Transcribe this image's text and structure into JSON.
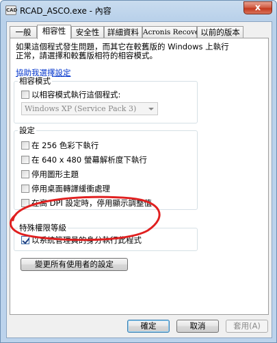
{
  "window": {
    "title": "RCAD_ASCO.exe - 內容",
    "app_icon_text": "CAD",
    "close_glyph": "x"
  },
  "tabs": [
    {
      "label": "一般",
      "active": false
    },
    {
      "label": "相容性",
      "active": true
    },
    {
      "label": "安全性",
      "active": false
    },
    {
      "label": "詳細資料",
      "active": false
    },
    {
      "label": "Acronis Recovery",
      "active": false
    },
    {
      "label": "以前的版本",
      "active": false
    }
  ],
  "compat": {
    "intro_line1": "如果這個程式發生問題，而其它在較舊版的 Windows 上執行",
    "intro_line2": "正常，請選擇和較舊版相符的相容模式。",
    "help_link": "協助我選擇設定"
  },
  "compat_mode": {
    "title": "相容模式",
    "checkbox_label": "以相容模式執行這個程式:",
    "checked": false,
    "select_value": "Windows XP (Service Pack 3)"
  },
  "settings": {
    "title": "設定",
    "items": [
      {
        "label": "在 256 色彩下執行",
        "checked": false
      },
      {
        "label": "在 640 x 480 螢幕解析度下執行",
        "checked": false
      },
      {
        "label": "停用圖形主題",
        "checked": false
      },
      {
        "label": "停用桌面轉譯緩衝處理",
        "checked": false
      },
      {
        "label": "在高 DPI 設定時，停用顯示調整值",
        "checked": false
      }
    ]
  },
  "privilege": {
    "title": "特殊權限等級",
    "checkbox_label": "以系統管理員的身分執行此程式",
    "checked": true
  },
  "change_all_button": "變更所有使用者的設定",
  "footer": {
    "ok": "確定",
    "cancel": "取消",
    "apply": "套用(A)"
  },
  "colors": {
    "annotation_circle": "#e02020",
    "link": "#0033cc",
    "titlebar": "#b9d1ea"
  }
}
